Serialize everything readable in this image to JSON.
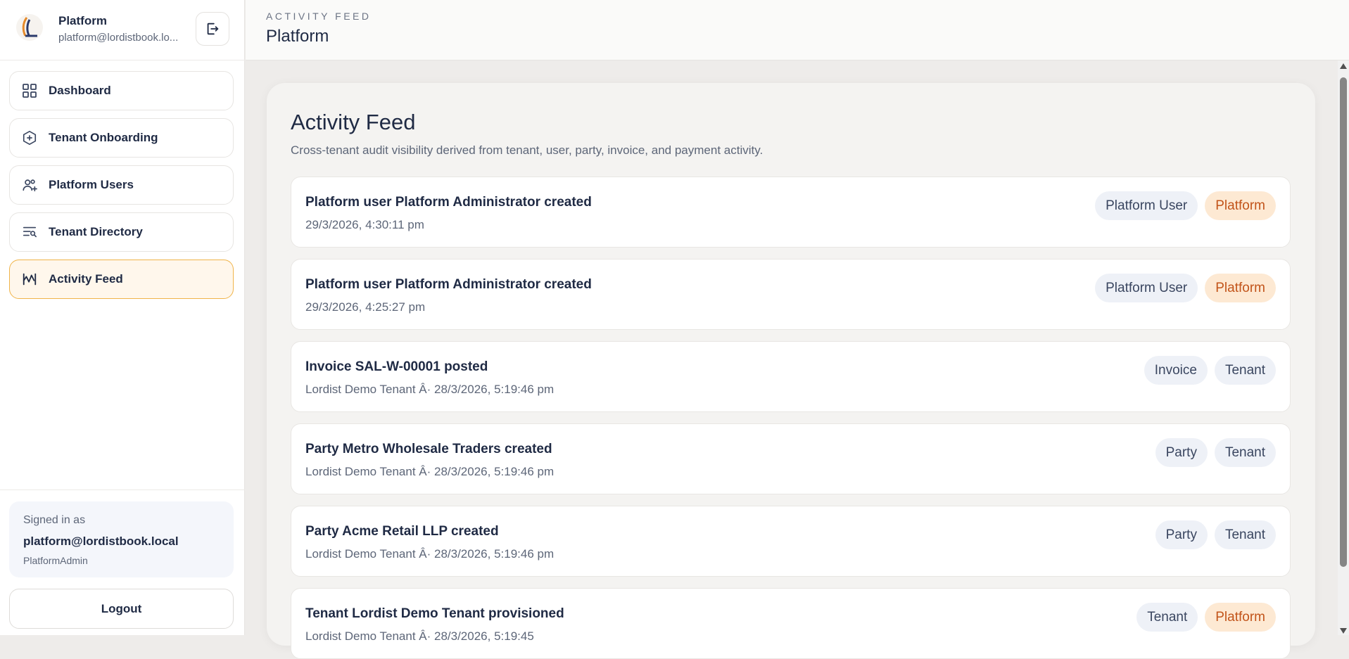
{
  "sidebar": {
    "brand_name": "Platform",
    "brand_email": "platform@lordistbook.lo...",
    "nav": [
      {
        "label": "Dashboard",
        "icon": "grid-icon"
      },
      {
        "label": "Tenant Onboarding",
        "icon": "hexagon-plus-icon"
      },
      {
        "label": "Platform Users",
        "icon": "users-plus-icon"
      },
      {
        "label": "Tenant Directory",
        "icon": "list-filter-icon"
      },
      {
        "label": "Activity Feed",
        "icon": "activity-icon",
        "active": true
      }
    ],
    "signed_in_label": "Signed in as",
    "signed_in_email": "platform@lordistbook.local",
    "signed_in_role": "PlatformAdmin",
    "logout_label": "Logout"
  },
  "header": {
    "eyebrow": "ACTIVITY FEED",
    "title": "Platform"
  },
  "main": {
    "title": "Activity Feed",
    "subtitle": "Cross-tenant audit visibility derived from tenant, user, party, invoice, and payment activity.",
    "items": [
      {
        "title": "Platform user Platform Administrator created",
        "meta": "29/3/2026, 4:30:11 pm",
        "tags": [
          "Platform User",
          "Platform"
        ]
      },
      {
        "title": "Platform user Platform Administrator created",
        "meta": "29/3/2026, 4:25:27 pm",
        "tags": [
          "Platform User",
          "Platform"
        ]
      },
      {
        "title": "Invoice SAL-W-00001 posted",
        "meta": "Lordist Demo Tenant Â· 28/3/2026, 5:19:46 pm",
        "tags": [
          "Invoice",
          "Tenant"
        ]
      },
      {
        "title": "Party Metro Wholesale Traders created",
        "meta": "Lordist Demo Tenant Â· 28/3/2026, 5:19:46 pm",
        "tags": [
          "Party",
          "Tenant"
        ]
      },
      {
        "title": "Party Acme Retail LLP created",
        "meta": "Lordist Demo Tenant Â· 28/3/2026, 5:19:46 pm",
        "tags": [
          "Party",
          "Tenant"
        ]
      },
      {
        "title": "Tenant Lordist Demo Tenant provisioned",
        "meta": "Lordist Demo Tenant Â· 28/3/2026, 5:19:45",
        "tags": [
          "Tenant",
          "Platform"
        ]
      }
    ]
  },
  "colors": {
    "accent": "#f0b44a",
    "platform_tag_bg": "#fde9d3",
    "platform_tag_text": "#c2541a",
    "neutral_tag_bg": "#eef1f7"
  }
}
